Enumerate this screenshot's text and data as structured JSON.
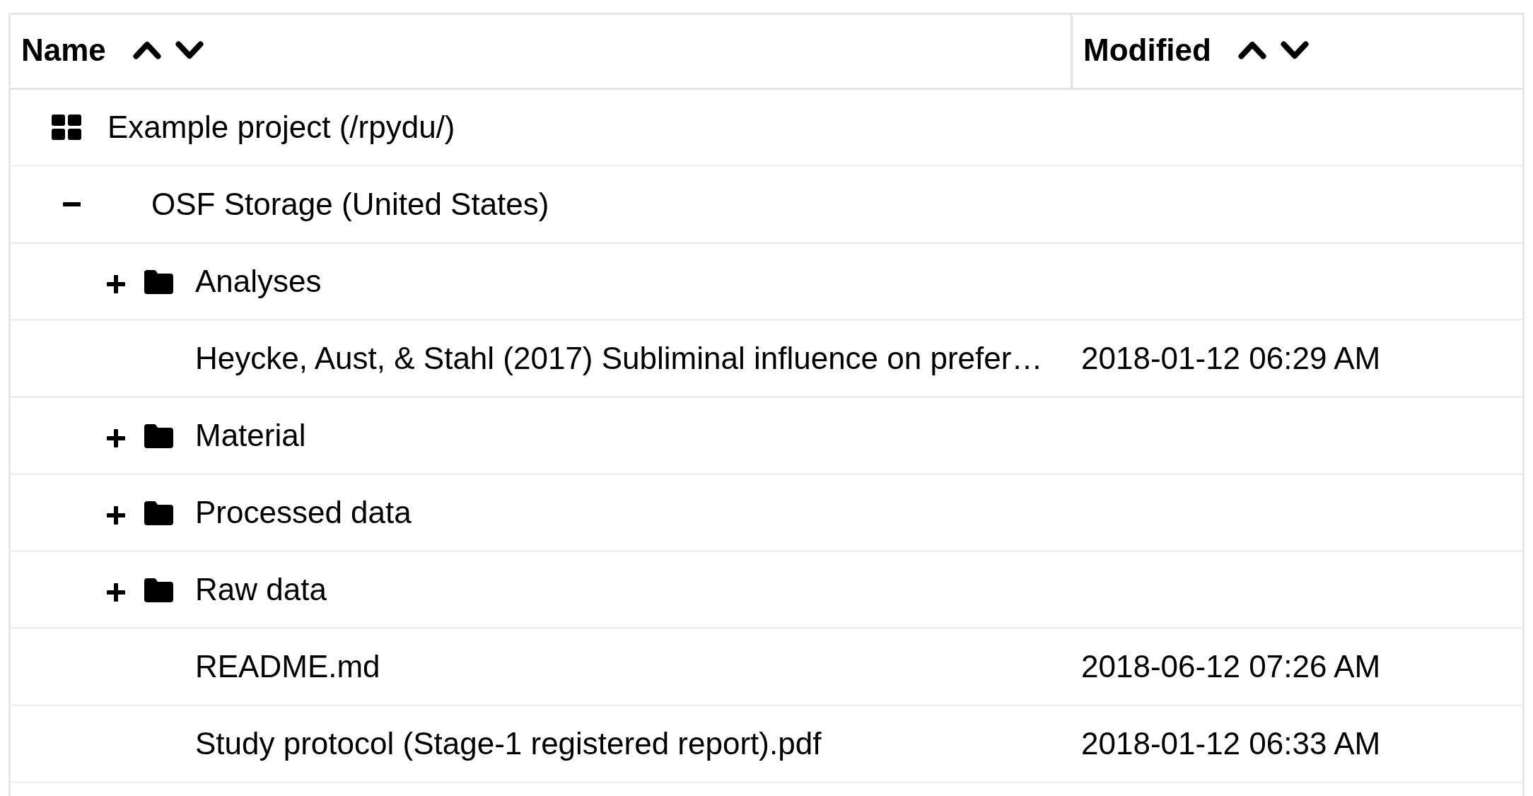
{
  "table": {
    "columns": [
      {
        "label": "Name"
      },
      {
        "label": "Modified"
      }
    ],
    "rows": [
      {
        "kind": "project",
        "name": "Example project (/rpydu/)",
        "children": [
          {
            "kind": "storage",
            "name": "OSF Storage (United States)",
            "expanded": true,
            "children": [
              {
                "kind": "folder",
                "name": "Analyses",
                "expanded": false
              },
              {
                "kind": "file",
                "name": "Heycke, Aust, & Stahl (2017) Subliminal influence on prefer…",
                "modified": "2018-01-12 06:29 AM"
              },
              {
                "kind": "folder",
                "name": "Material",
                "expanded": false
              },
              {
                "kind": "folder",
                "name": "Processed data",
                "expanded": false
              },
              {
                "kind": "folder",
                "name": "Raw data",
                "expanded": false
              },
              {
                "kind": "file",
                "name": "README.md",
                "modified": "2018-06-12 07:26 AM"
              },
              {
                "kind": "file",
                "name": "Study protocol (Stage-1 registered report).pdf",
                "modified": "2018-01-12 06:33 AM"
              }
            ]
          }
        ]
      }
    ]
  }
}
